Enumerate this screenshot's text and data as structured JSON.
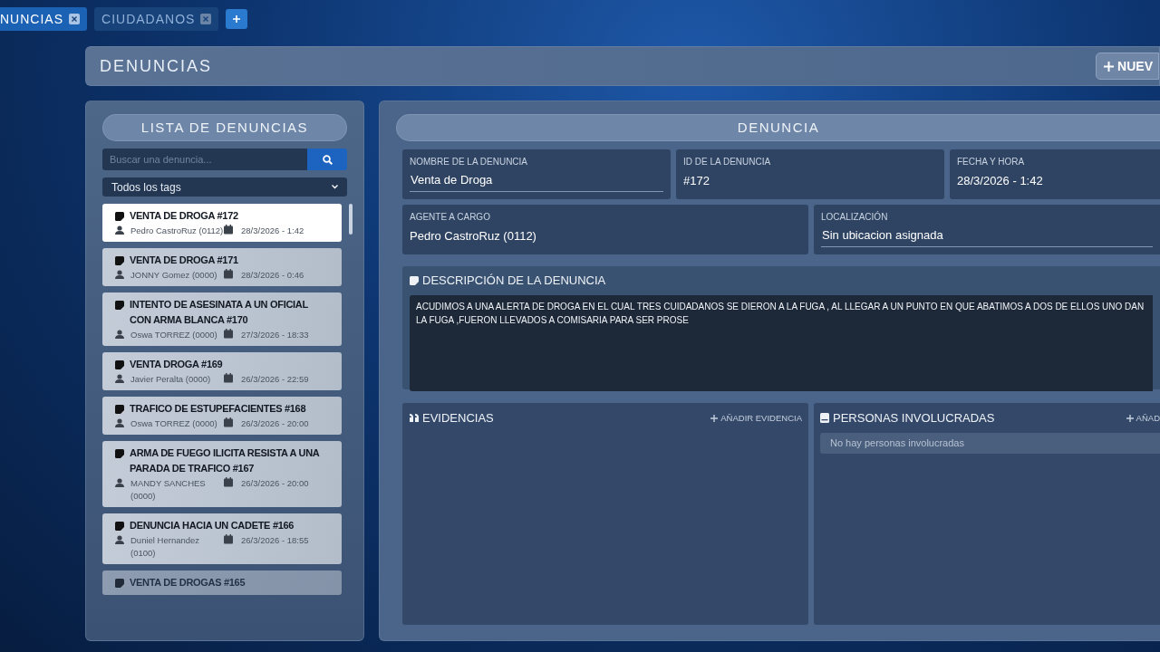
{
  "tabs": [
    {
      "label": "NUNCIAS",
      "selected": true
    },
    {
      "label": "CIUDADANOS",
      "selected": false
    }
  ],
  "header": {
    "title": "DENUNCIAS",
    "new_button": "NUEV"
  },
  "list_panel": {
    "title": "LISTA DE DENUNCIAS",
    "search": {
      "placeholder": "Buscar una denuncia..."
    },
    "tag_filter": "Todos los tags",
    "items": [
      {
        "title": "VENTA DE DROGA #172",
        "agent": "Pedro CastroRuz (0112)",
        "date": "28/3/2026 - 1:42",
        "selected": true
      },
      {
        "title": "VENTA DE DROGA #171",
        "agent": "JONNY Gomez (0000)",
        "date": "28/3/2026 - 0:46",
        "selected": false
      },
      {
        "title": "INTENTO DE ASESINATA A UN OFICIAL CON ARMA BLANCA #170",
        "agent": "Oswa TORREZ (0000)",
        "date": "27/3/2026 - 18:33",
        "selected": false
      },
      {
        "title": "VENTA DROGA #169",
        "agent": "Javier Peralta (0000)",
        "date": "26/3/2026 - 22:59",
        "selected": false
      },
      {
        "title": "TRAFICO DE ESTUPEFACIENTES #168",
        "agent": "Oswa TORREZ (0000)",
        "date": "26/3/2026 - 20:00",
        "selected": false
      },
      {
        "title": "ARMA DE FUEGO ILICITA RESISTA A UNA PARADA DE TRAFICO #167",
        "agent": "MANDY SANCHES (0000)",
        "date": "26/3/2026 - 20:00",
        "selected": false
      },
      {
        "title": "DENUNCIA HACIA UN CADETE #166",
        "agent": "Duniel Hernandez (0100)",
        "date": "26/3/2026 - 18:55",
        "selected": false
      },
      {
        "title": "VENTA DE DROGAS #165",
        "selected": false
      }
    ]
  },
  "detail": {
    "title": "DENUNCIA",
    "fields": [
      {
        "label": "NOMBRE DE LA DENUNCIA",
        "value": "Venta de Droga",
        "kind": "input"
      },
      {
        "label": "ID DE LA DENUNCIA",
        "value": "#172",
        "kind": "text"
      },
      {
        "label": "FECHA Y HORA",
        "value": "28/3/2026 - 1:42",
        "kind": "text"
      },
      {
        "label": "AGENTE A CARGO",
        "value": "Pedro CastroRuz (0112)",
        "kind": "text"
      },
      {
        "label": "LOCALIZACIÓN",
        "value": "Sin ubicacion asignada",
        "kind": "input"
      }
    ],
    "description": {
      "label": "DESCRIPCIÓN DE LA DENUNCIA",
      "lines": [
        "ACUDIMOS A UNA ALERTA DE DROGA EN EL CUAL TRES CUIDADANOS SE DIERON A LA FUGA , AL LLEGAR A UN PUNTO EN QUE ABATIMOS A DOS DE ELLOS UNO DAN",
        "LA FUGA ,FUERON LLEVADOS A COMISARIA PARA SER PROSE"
      ]
    },
    "evidence": {
      "title": "EVIDENCIAS",
      "add": "AÑADIR EVIDENCIA"
    },
    "people": {
      "title": "PERSONAS INVOLUCRADAS",
      "add": "AÑAD",
      "empty": "No hay personas involucradas"
    }
  }
}
